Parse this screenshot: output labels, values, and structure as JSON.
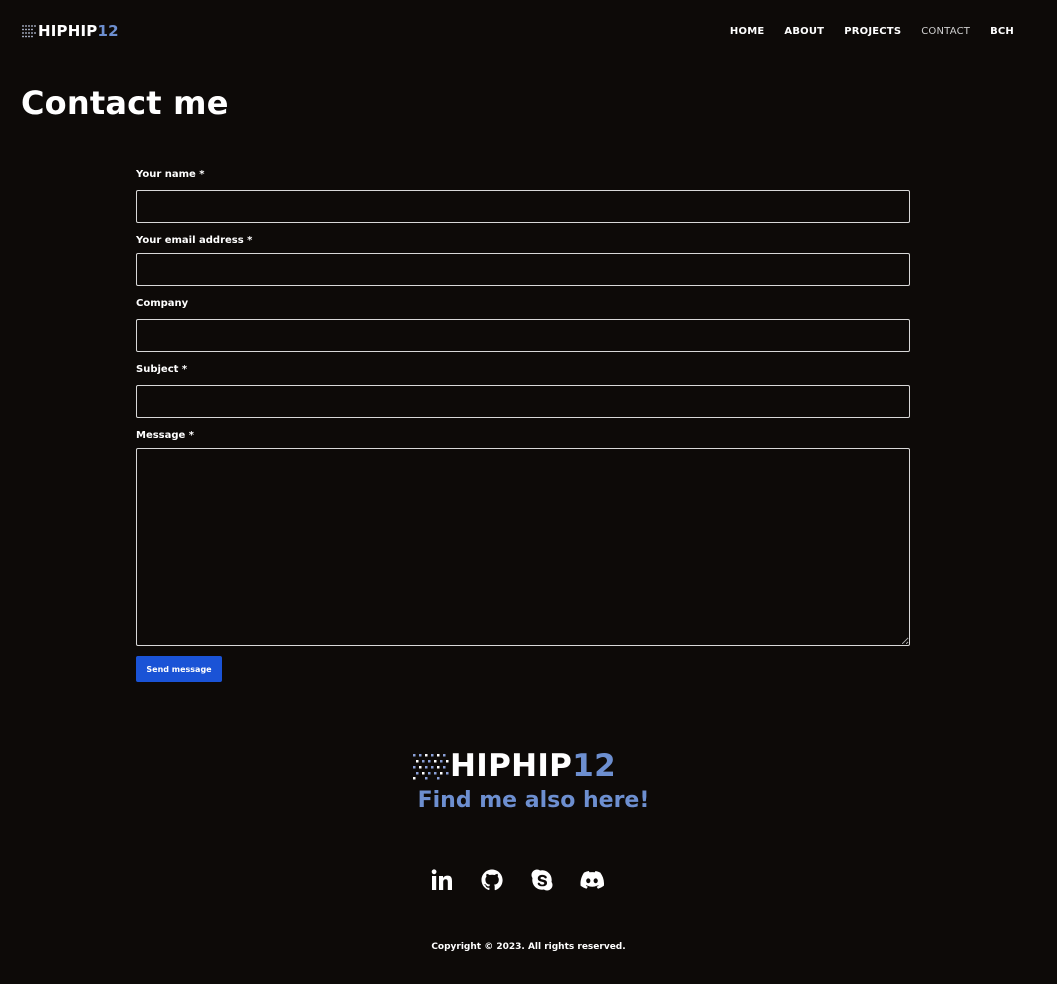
{
  "header": {
    "logo_text_white": "HIPHIP",
    "logo_text_blue": "12",
    "nav": [
      {
        "label": "HOME"
      },
      {
        "label": "ABOUT"
      },
      {
        "label": "PROJECTS"
      },
      {
        "label": "CONTACT",
        "active": true
      },
      {
        "label": "BCH"
      }
    ]
  },
  "page": {
    "title": "Contact me"
  },
  "form": {
    "name_label": "Your name *",
    "email_label": "Your email address *",
    "company_label": "Company",
    "subject_label": "Subject *",
    "message_label": "Message *",
    "name_value": "",
    "email_value": "",
    "company_value": "",
    "subject_value": "",
    "message_value": "",
    "submit_label": "Send message"
  },
  "footer": {
    "logo_text_white": "HIPHIP",
    "logo_text_blue": "12",
    "tagline": "Find me also here!",
    "social": [
      {
        "icon": "linkedin-icon"
      },
      {
        "icon": "github-icon"
      },
      {
        "icon": "skype-icon"
      },
      {
        "icon": "discord-icon"
      }
    ],
    "copyright": "Copyright © 2023. All rights reserved."
  },
  "colors": {
    "background": "#0d0a08",
    "accent_blue": "#6d8fd0",
    "button_blue": "#1a53d6"
  }
}
